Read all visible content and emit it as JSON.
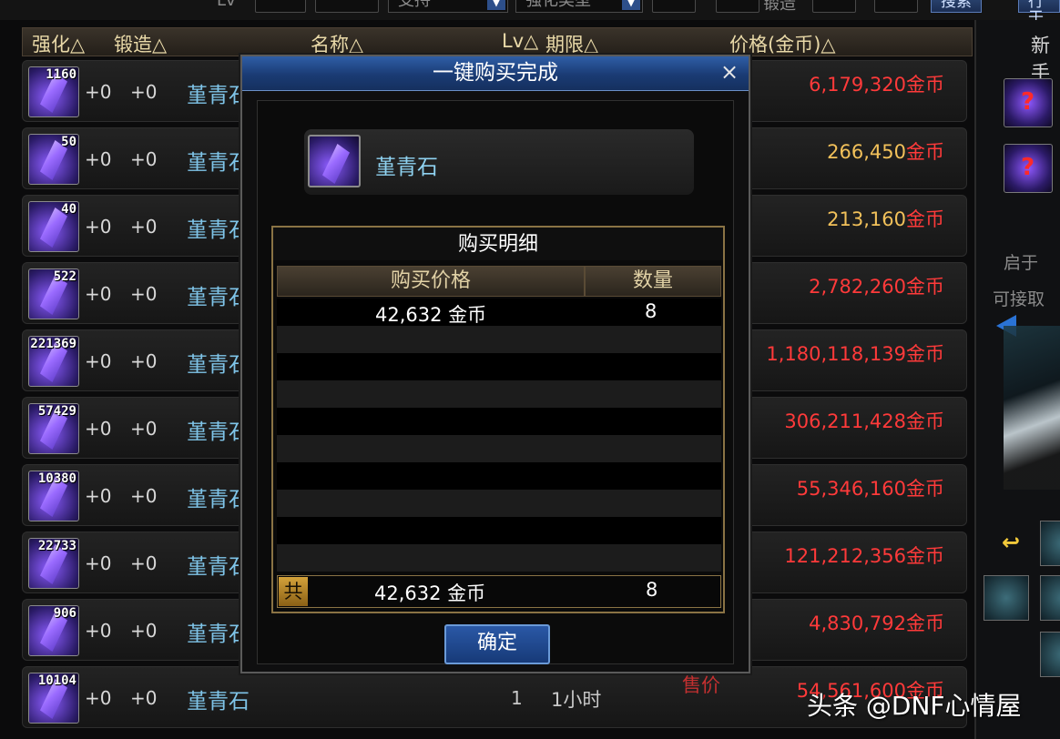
{
  "topbar": {
    "lv_label": "Lv",
    "select1": "支持",
    "select2": "强化类型",
    "forge_label": "锻造",
    "search_button": "搜索",
    "other_button": "行于"
  },
  "list": {
    "headers": [
      "强化△",
      "锻造△",
      "名称△",
      "Lv△",
      "期限△",
      "价格(金币)△"
    ],
    "currency": "金币",
    "sale_tag": "售价",
    "rows": [
      {
        "qty": "1160",
        "str": "+0",
        "forge": "+0",
        "name": "堇青石",
        "price": "6,179,320",
        "price_class": "p-red"
      },
      {
        "qty": "50",
        "str": "+0",
        "forge": "+0",
        "name": "堇青石",
        "price": "266,450",
        "price_class": "p-gold"
      },
      {
        "qty": "40",
        "str": "+0",
        "forge": "+0",
        "name": "堇青石",
        "price": "213,160",
        "price_class": "p-gold"
      },
      {
        "qty": "522",
        "str": "+0",
        "forge": "+0",
        "name": "堇青石",
        "price": "2,782,260",
        "price_class": "p-red"
      },
      {
        "qty": "221369",
        "str": "+0",
        "forge": "+0",
        "name": "堇青石",
        "price": "1,180,118,139",
        "price_class": "p-red"
      },
      {
        "qty": "57429",
        "str": "+0",
        "forge": "+0",
        "name": "堇青石",
        "price": "306,211,428",
        "price_class": "p-red"
      },
      {
        "qty": "10380",
        "str": "+0",
        "forge": "+0",
        "name": "堇青石",
        "price": "55,346,160",
        "price_class": "p-red"
      },
      {
        "qty": "22733",
        "str": "+0",
        "forge": "+0",
        "name": "堇青石",
        "price": "121,212,356",
        "price_class": "p-red"
      },
      {
        "qty": "906",
        "str": "+0",
        "forge": "+0",
        "name": "堇青石",
        "price": "4,830,792",
        "price_class": "p-red"
      },
      {
        "qty": "10104",
        "str": "+0",
        "forge": "+0",
        "name": "堇青石",
        "lv": "1",
        "time": "1小时",
        "price": "54,561,600",
        "price_class": "p-red"
      }
    ]
  },
  "right_panel": {
    "title": "新手",
    "side_text_1": "启于",
    "side_text_2": "可接取"
  },
  "modal": {
    "title": "一键购买完成",
    "close": "×",
    "item_name": "堇青石",
    "detail_title": "购买明细",
    "col_price": "购买价格",
    "col_qty": "数量",
    "line_price": "42,632 金币",
    "line_qty": "8",
    "total_label": "共",
    "total_price": "42,632 金币",
    "total_qty": "8",
    "confirm": "确定"
  },
  "watermark": "头条 @DNF心情屋",
  "colors": {
    "price_red": "#ff3a3a",
    "price_gold": "#f2c15a",
    "title_blue": "#2f5ea6",
    "gold_border": "#8a7344",
    "item_name_cyan": "#7fc4e8"
  }
}
